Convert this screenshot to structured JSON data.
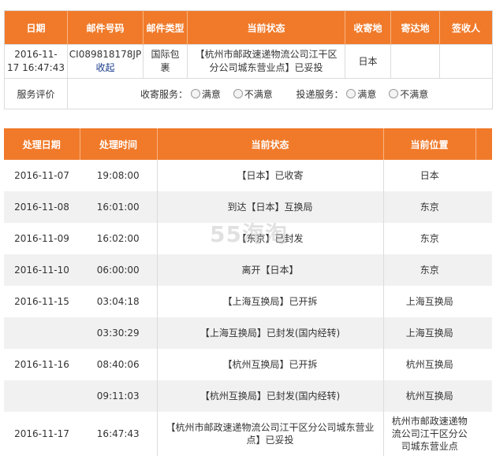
{
  "summary": {
    "headers": [
      "日期",
      "邮件号码",
      "邮件类型",
      "当前状态",
      "收寄地",
      "寄达地",
      "签收人"
    ],
    "row": {
      "date_line1": "2016-11-",
      "date_line2": "17 16:47:43",
      "mail_no": "CI089818178JP",
      "collapse_link": "收起",
      "mail_type_line1": "国际包",
      "mail_type_line2": "裹",
      "status_line1": "【杭州市邮政速递物流公司江干区",
      "status_line2": "分公司城东营业点】已妥投",
      "origin": "日本",
      "destination": "",
      "signer": ""
    },
    "evaluation": {
      "label": "服务评价",
      "collect_label": "收寄服务：",
      "deliver_label": "投递服务：",
      "satisfied": "满意",
      "unsatisfied": "不满意"
    }
  },
  "tracking": {
    "headers": [
      "处理日期",
      "处理时间",
      "当前状态",
      "当前位置"
    ],
    "rows": [
      {
        "date": "2016-11-07",
        "time": "19:08:00",
        "status": "【日本】已收寄",
        "location": "日本"
      },
      {
        "date": "2016-11-08",
        "time": "16:01:00",
        "status": "到达【日本】互换局",
        "location": "东京"
      },
      {
        "date": "2016-11-09",
        "time": "16:02:00",
        "status": "【东京】已封发",
        "location": "东京"
      },
      {
        "date": "2016-11-10",
        "time": "06:00:00",
        "status": "离开【日本】",
        "location": "东京"
      },
      {
        "date": "2016-11-15",
        "time": "03:04:18",
        "status": "【上海互换局】已开拆",
        "location": "上海互换局"
      },
      {
        "date": "",
        "time": "03:30:29",
        "status": "【上海互换局】已封发(国内经转)",
        "location": "上海互换局"
      },
      {
        "date": "2016-11-16",
        "time": "08:40:06",
        "status": "【杭州互换局】已开拆",
        "location": "杭州互换局"
      },
      {
        "date": "",
        "time": "09:11:03",
        "status": "【杭州互换局】已封发(国内经转)",
        "location": "杭州互换局"
      },
      {
        "date": "2016-11-17",
        "time": "16:47:43",
        "status_line1": "【杭州市邮政速递物流公司江干区分公司城东营业",
        "status_line2": "点】已妥投",
        "location_line1": "杭州市邮政速递物",
        "location_line2": "流公司江干区分公",
        "location_line3": "司城东营业点"
      }
    ]
  },
  "watermark": "55海淘",
  "colors": {
    "header_bg": "#f07a2a",
    "header_text": "#ffffff",
    "link": "#1a3c8c",
    "stripe": "#f1f1f1"
  }
}
